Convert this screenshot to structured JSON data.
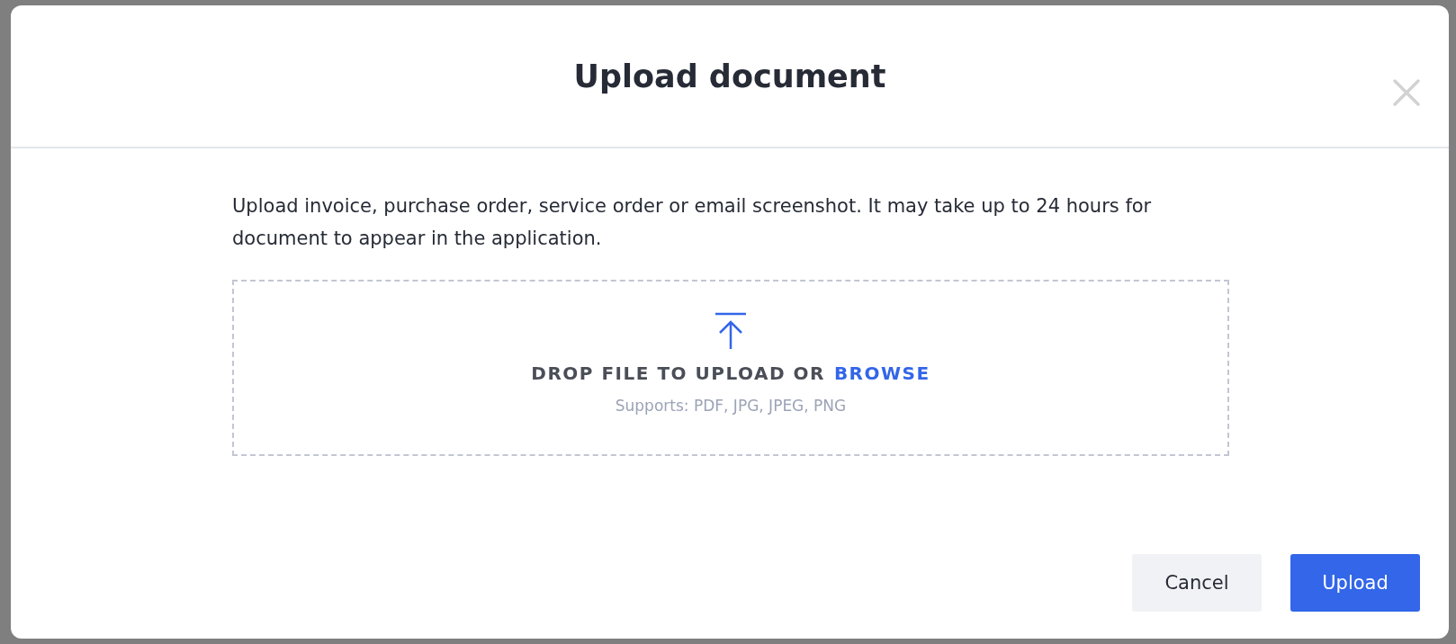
{
  "dialog": {
    "title": "Upload document",
    "description": "Upload invoice, purchase order, service order or email screenshot. It may take up to 24 hours for document to appear in the application.",
    "dropzone": {
      "prompt": "DROP FILE TO UPLOAD OR",
      "link": "BROWSE",
      "hint": "Supports: PDF, JPG, JPEG, PNG"
    },
    "buttons": [
      {
        "label": "Cancel",
        "kind": "secondary"
      },
      {
        "label": "Upload",
        "kind": "primary"
      }
    ]
  }
}
